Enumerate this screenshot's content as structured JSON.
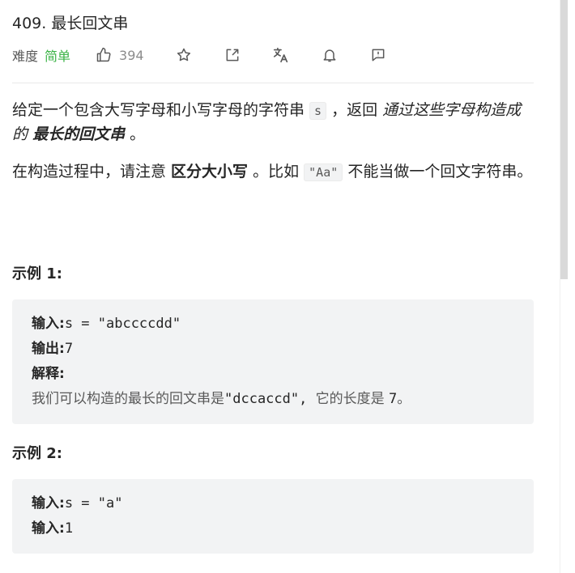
{
  "problem": {
    "title": "409. 最长回文串",
    "difficulty_label": "难度",
    "difficulty": "简单",
    "likes": "394"
  },
  "icons": {
    "like": "thumbs-up-icon",
    "star": "star-icon",
    "share": "share-icon",
    "translate": "translate-icon",
    "notify": "bell-icon",
    "feedback": "comment-icon"
  },
  "description": {
    "p1_a": "给定一个包含大写字母和小写字母的字符串 ",
    "p1_code": "s",
    "p1_b": " ，返回 ",
    "p1_italic": "通过这些字母构造成的",
    "p1_bold": "最长的回文串",
    "p1_end": " 。",
    "p2_a": "在构造过程中，请注意 ",
    "p2_bold": "区分大小写",
    "p2_b": " 。比如 ",
    "p2_code": "\"Aa\"",
    "p2_c": " 不能当做一个回文字符串。"
  },
  "examples": [
    {
      "heading": "示例 1:",
      "input_label": "输入:",
      "input": "s = \"abccccdd\"",
      "output_label": "输出:",
      "output": "7",
      "explain_label": "解释:",
      "explain_a": "我们可以构造的最长的回文串是",
      "explain_code": "\"dccaccd\", ",
      "explain_b": "它的长度是 ",
      "explain_num": "7",
      "explain_end": "。"
    },
    {
      "heading": "示例 2:",
      "input_label": "输入:",
      "input": "s = \"a\"",
      "output_label": "输入:",
      "output": "1"
    }
  ],
  "colors": {
    "easy": "#3bb346",
    "code_bg": "#f2f3f4"
  }
}
